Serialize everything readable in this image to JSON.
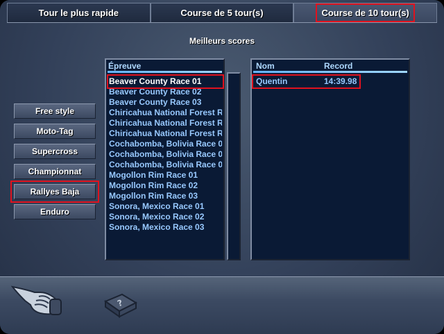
{
  "tabs": [
    {
      "label": "Tour le plus rapide",
      "active": false
    },
    {
      "label": "Course de 5 tour(s)",
      "active": false
    },
    {
      "label": "Course de 10 tour(s)",
      "active": true
    }
  ],
  "section_title": "Meilleurs scores",
  "modes": [
    {
      "label": "Free style"
    },
    {
      "label": "Moto-Tag"
    },
    {
      "label": "Supercross"
    },
    {
      "label": "Championnat"
    },
    {
      "label": "Rallyes Baja",
      "selected": true
    },
    {
      "label": "Enduro"
    }
  ],
  "events_panel": {
    "header": "Épreuve",
    "items": [
      "Beaver County Race 01",
      "Beaver County Race 02",
      "Beaver County Race 03",
      "Chiricahua National Forest R",
      "Chiricahua National Forest R",
      "Chiricahua National Forest R",
      "Cochabomba, Bolivia Race 0",
      "Cochabomba, Bolivia Race 0",
      "Cochabomba, Bolivia Race 0",
      "Mogollon Rim Race 01",
      "Mogollon Rim Race 02",
      "Mogollon Rim Race 03",
      "Sonora, Mexico Race 01",
      "Sonora, Mexico Race 02",
      "Sonora, Mexico Race 03"
    ],
    "selected_index": 0
  },
  "scores_panel": {
    "header_name": "Nom",
    "header_record": "Record",
    "rows": [
      {
        "name": "Quentin",
        "record": "14:39.98"
      }
    ]
  },
  "icons": {
    "back": "pointing-hand-icon",
    "help": "help-book-icon"
  },
  "colors": {
    "highlight": "#e0121e",
    "list_text": "#98c9ff",
    "header_text": "#aed8ff"
  }
}
